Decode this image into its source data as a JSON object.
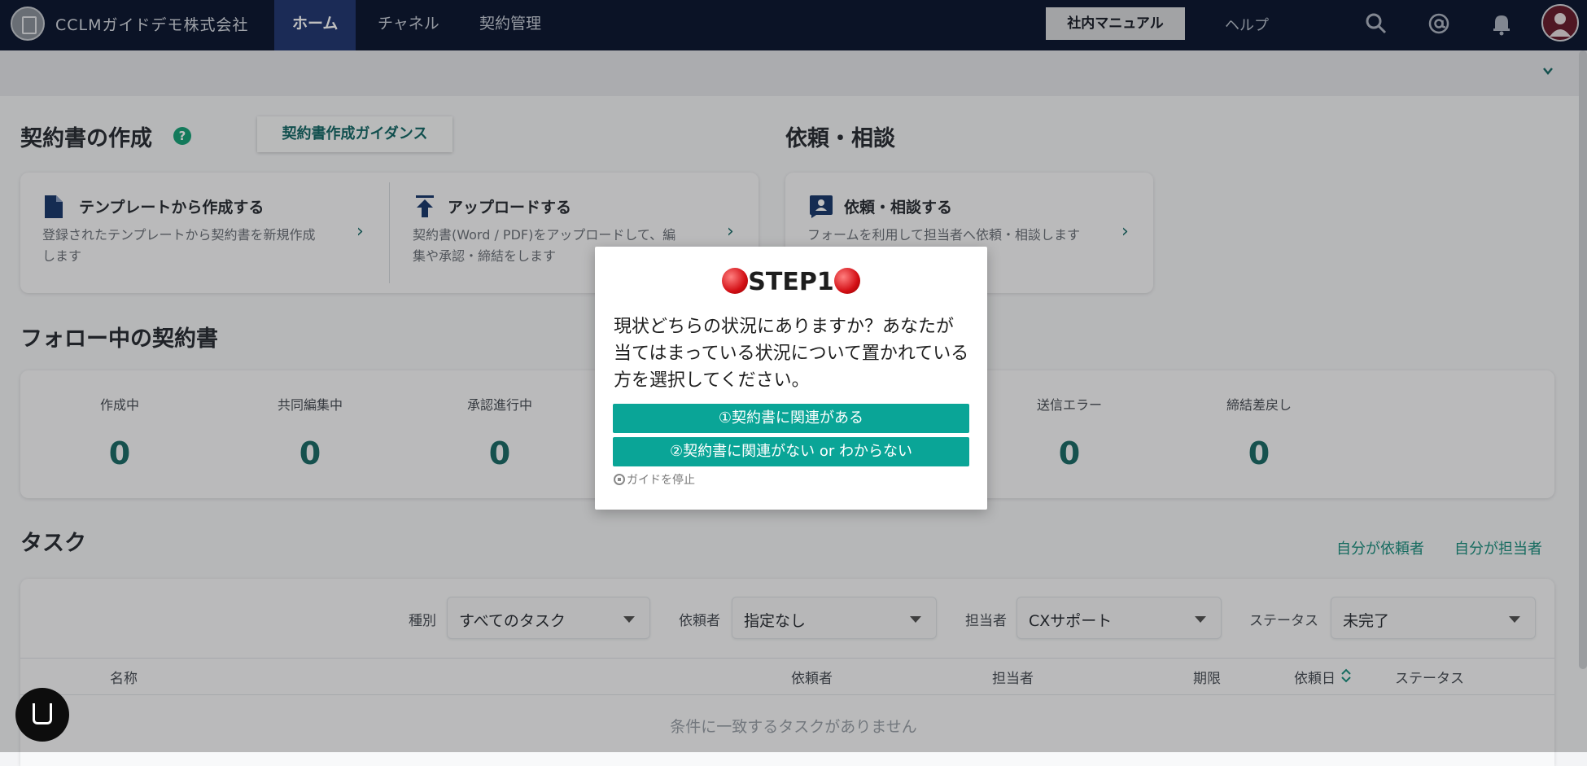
{
  "topbar": {
    "company": "CCLMガイドデモ株式会社",
    "nav": [
      "ホーム",
      "チャネル",
      "契約管理"
    ],
    "active_nav": "ホーム",
    "manual_button": "社内マニュアル",
    "help": "ヘルプ",
    "icons": [
      "search-icon",
      "mention-icon",
      "bell-icon",
      "avatar"
    ]
  },
  "create": {
    "title": "契約書の作成",
    "help_symbol": "?",
    "guide_button": "契約書作成ガイダンス",
    "template_title": "テンプレートから作成する",
    "template_desc_1": "登録されたテンプレートから契約書を新規作成",
    "template_desc_2": "します",
    "upload_title": "アップロードする",
    "upload_desc_1": "契約書(Word / PDF)をアップロードして、編",
    "upload_desc_2": "集や承認・締結をします"
  },
  "request": {
    "title": "依頼・相談",
    "card_title": "依頼・相談する",
    "card_desc": "フォームを利用して担当者へ依頼・相談します"
  },
  "following": {
    "title": "フォロー中の契約書",
    "stats": [
      {
        "label": "作成中",
        "value": "0"
      },
      {
        "label": "共同編集中",
        "value": "0"
      },
      {
        "label": "承認進行中",
        "value": "0"
      },
      {
        "label": "送信エラー",
        "value": "0"
      },
      {
        "label": "締結差戻し",
        "value": "0"
      }
    ]
  },
  "tasks": {
    "title": "タスク",
    "link_requester": "自分が依頼者",
    "link_assignee": "自分が担当者",
    "filters": [
      {
        "label": "種別",
        "value": "すべてのタスク"
      },
      {
        "label": "依頼者",
        "value": "指定なし"
      },
      {
        "label": "担当者",
        "value": "CXサポート"
      },
      {
        "label": "ステータス",
        "value": "未完了"
      }
    ],
    "columns": [
      "名称",
      "依頼者",
      "担当者",
      "期限",
      "依頼日",
      "ステータス"
    ],
    "empty": "条件に一致するタスクがありません"
  },
  "modal": {
    "step": "STEP1",
    "question": "現状どちらの状況にありますか？あなたが当てはまっている状況について置かれている方を選択してください。",
    "q_line1": "現状どちらの状況にありますか？あなたが",
    "q_line2": "当てはまっている状況について置かれている",
    "q_line3": "方を選択してください。",
    "choice1": "①契約書に関連がある",
    "choice2": "②契約書に関連がない or わからない",
    "stop": "ガイドを停止"
  },
  "colors": {
    "topbar": "#0f1a33",
    "nav_active": "#243a73",
    "accent": "#1e6d69",
    "choice_button": "#0aa597"
  }
}
